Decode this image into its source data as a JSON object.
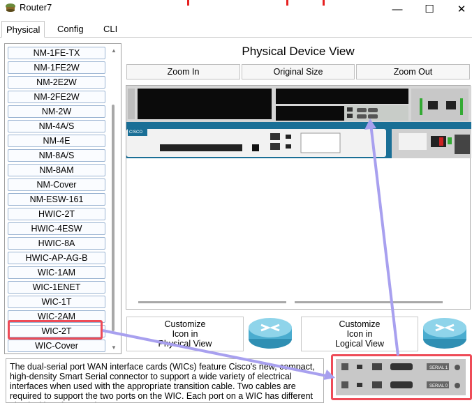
{
  "window": {
    "title": "Router7",
    "minimize": "—",
    "maximize": "☐",
    "close": "✕"
  },
  "tabs": [
    {
      "label": "Physical"
    },
    {
      "label": "Config"
    },
    {
      "label": "CLI"
    }
  ],
  "module_list": {
    "items": [
      "NM-1FE-TX",
      "NM-1FE2W",
      "NM-2E2W",
      "NM-2FE2W",
      "NM-2W",
      "NM-4A/S",
      "NM-4E",
      "NM-8A/S",
      "NM-8AM",
      "NM-Cover",
      "NM-ESW-161",
      "HWIC-2T",
      "HWIC-4ESW",
      "HWIC-8A",
      "HWIC-AP-AG-B",
      "WIC-1AM",
      "WIC-1ENET",
      "WIC-1T",
      "WIC-2AM",
      "WIC-2T",
      "WIC-Cover"
    ],
    "selected": "WIC-2T"
  },
  "device_view": {
    "title": "Physical Device View",
    "zoom_in": "Zoom In",
    "original_size": "Original Size",
    "zoom_out": "Zoom Out",
    "brand": "CISCO",
    "serial_labels": [
      "SERIAL 1",
      "SERIAL 0"
    ]
  },
  "customize": {
    "physical": {
      "line1": "Customize",
      "line2": "Icon in",
      "line3": "Physical View"
    },
    "logical": {
      "line1": "Customize",
      "line2": "Icon in",
      "line3": "Logical View"
    }
  },
  "description": "The dual-serial port WAN interface cards (WICs) feature Cisco's new, compact, high-density Smart Serial connector to support a wide variety of electrical interfaces when used with the appropriate transition cable. Two cables are required to support the two ports on the WIC. Each port on a WIC has different physical interface cards",
  "colors": {
    "highlight": "#ee4b57",
    "arrow": "#a8a0ef",
    "router_blue": "#1a6f96"
  }
}
